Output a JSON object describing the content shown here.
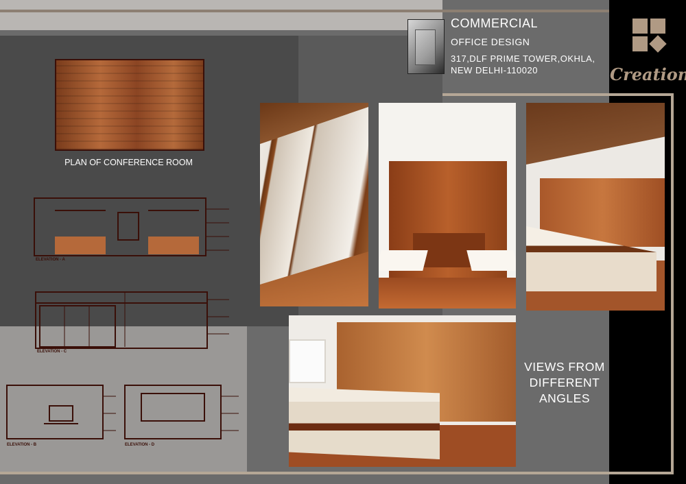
{
  "header": {
    "title": "COMMERCIAL",
    "subtitle": "OFFICE DESIGN",
    "address_line1": "317,DLF PRIME TOWER,OKHLA,",
    "address_line2": "NEW DELHI-110020"
  },
  "logo": {
    "text": "Creations"
  },
  "plan": {
    "label": "PLAN OF CONFERENCE ROOM",
    "elevation_a": "ELEVATION - A",
    "elevation_c": "ELEVATION - C",
    "elevation_b": "ELEVATION - B",
    "elevation_d": "ELEVATION - D"
  },
  "views": {
    "line1": "VIEWS FROM",
    "line2": "DIFFERENT",
    "line3": "ANGLES"
  },
  "colors": {
    "accent_wood": "#b5693a",
    "line_dark": "#3a0f08",
    "frame": "#b5a796",
    "logo": "#b09a84"
  }
}
